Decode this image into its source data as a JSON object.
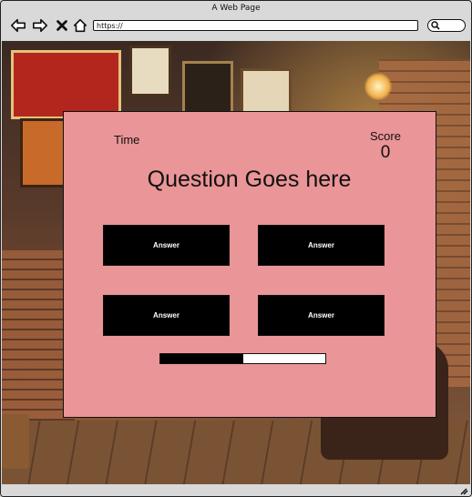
{
  "window": {
    "title": "A Web Page"
  },
  "toolbar": {
    "back_icon": "arrow-left-icon",
    "forward_icon": "arrow-right-icon",
    "close_icon": "close-icon",
    "home_icon": "home-icon",
    "url": "https://",
    "search_icon": "search-icon"
  },
  "quiz": {
    "time_label": "Time",
    "score_label": "Score",
    "score_value": "0",
    "question": "Question Goes here",
    "answers": [
      "Answer",
      "Answer",
      "Answer",
      "Answer"
    ],
    "progress_fraction": 0.5
  },
  "colors": {
    "modal_background": "#ea9597",
    "answer_background": "#000000",
    "answer_text": "#ffffff"
  }
}
